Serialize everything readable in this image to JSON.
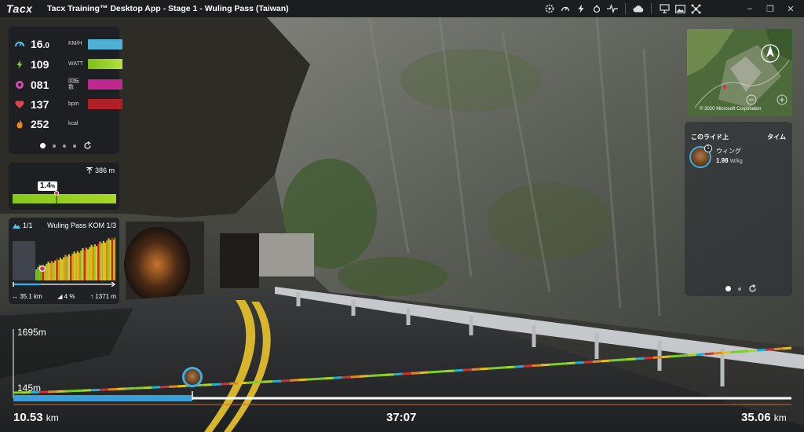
{
  "titlebar": {
    "logo": "Tacx",
    "title": "Tacx Training™ Desktop App - Stage 1 - Wuling Pass (Taiwan)",
    "icons": [
      "settings-gear-icon",
      "speedometer-icon",
      "power-icon",
      "sensor-icon",
      "heartrate-icon",
      "cloud-icon",
      "screen-share-icon",
      "image-icon",
      "network-icon"
    ],
    "window_controls": [
      "–",
      "❐",
      "✕"
    ]
  },
  "stats": {
    "rows": [
      {
        "icon": "speed-icon",
        "value": "16",
        "decimal": ".0",
        "unit": "KM/H",
        "color": "#4fb0d6",
        "icon_color": "#56c6f0"
      },
      {
        "icon": "power-icon",
        "value": "109",
        "decimal": "",
        "unit": "WATT",
        "color": "#9bd12a",
        "icon_color": "#8ccf2a"
      },
      {
        "icon": "cadence-icon",
        "value": "081",
        "decimal": "",
        "unit": "回転数",
        "color": "#c0278f",
        "icon_color": "#e04bb6"
      },
      {
        "icon": "heart-icon",
        "value": "137",
        "decimal": "",
        "unit": "bpm",
        "color": "#b12027",
        "icon_color": "#e0454e"
      },
      {
        "icon": "flame-icon",
        "value": "252",
        "decimal": "",
        "unit": "kcal",
        "color": "",
        "icon_color": "#f08a1e"
      }
    ],
    "page_dots": 4,
    "active_dot": 0
  },
  "gradient": {
    "elevation": "386 m",
    "grade": "1.4",
    "grade_unit": "%"
  },
  "climb": {
    "count": "1/1",
    "name": "Wuling Pass KOM 1/3",
    "distance": "35.1 km",
    "avg_grade": "4 %",
    "ascent": "1371 m",
    "progress": 0.27
  },
  "minimap": {
    "copyright": "© 2020 Microsoft Corporation"
  },
  "leaderboard": {
    "header_left": "このライド上",
    "header_right": "タイム",
    "entries": [
      {
        "rank": "1",
        "name": "ウィング",
        "value": "1.98",
        "unit": "W/kg"
      }
    ],
    "page_dots": 2,
    "active_dot": 0
  },
  "profile": {
    "max_elev": "1695m",
    "min_elev": "145m",
    "current_distance": "10.53",
    "total_distance": "35.06",
    "distance_unit": "km",
    "elapsed_time": "37:07",
    "progress": 0.2375
  }
}
